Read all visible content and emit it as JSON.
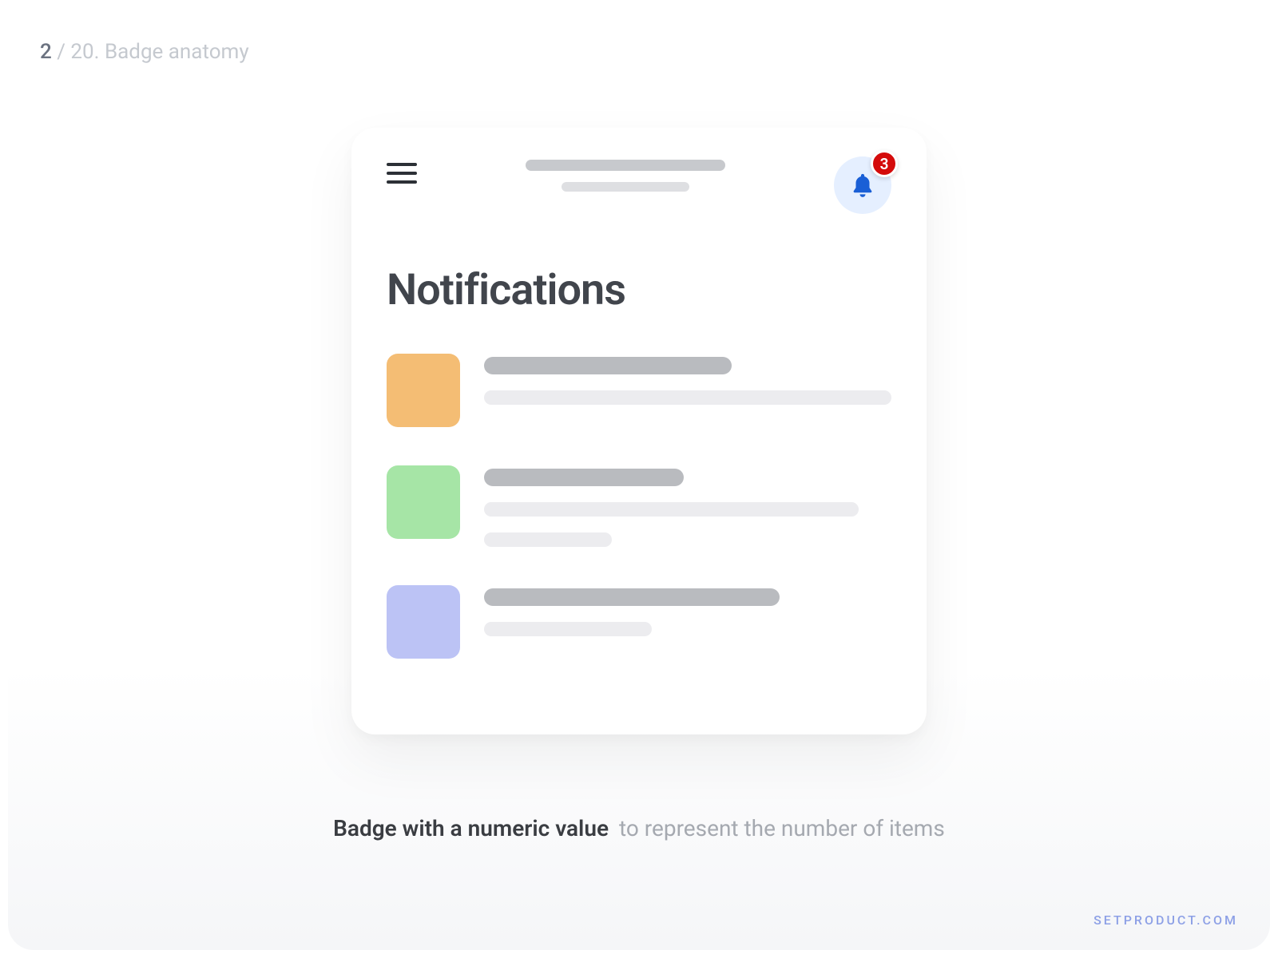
{
  "slide": {
    "current": "2",
    "separator": " / ",
    "total_and_title": "20. Badge anatomy"
  },
  "card": {
    "title": "Notifications",
    "badge_count": "3",
    "items": [
      {
        "thumb_color": "orange"
      },
      {
        "thumb_color": "green"
      },
      {
        "thumb_color": "purple"
      }
    ]
  },
  "caption": {
    "strong": "Badge with a numeric value",
    "light": "to represent the number of items"
  },
  "watermark": "SETPRODUCT.COM"
}
